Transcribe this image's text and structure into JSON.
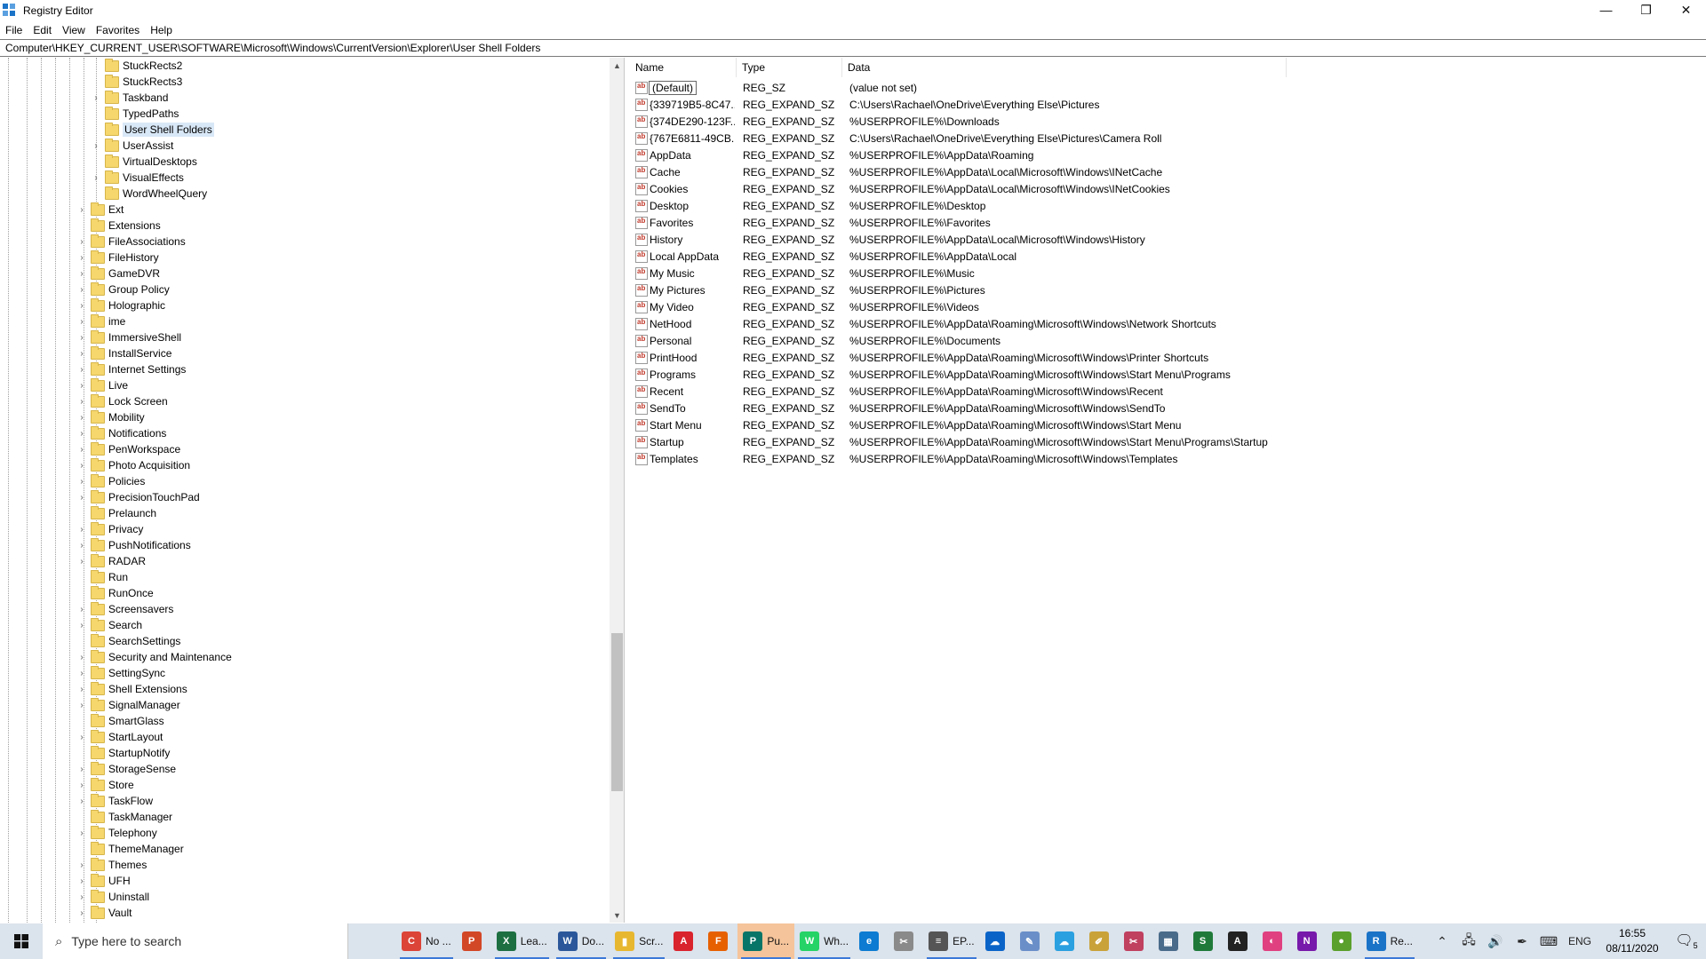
{
  "window": {
    "title": "Registry Editor"
  },
  "menu": [
    "File",
    "Edit",
    "View",
    "Favorites",
    "Help"
  ],
  "address": "Computer\\HKEY_CURRENT_USER\\SOFTWARE\\Microsoft\\Windows\\CurrentVersion\\Explorer\\User Shell Folders",
  "tree": [
    {
      "label": "StuckRects2",
      "level": 2,
      "expandable": false
    },
    {
      "label": "StuckRects3",
      "level": 2,
      "expandable": false
    },
    {
      "label": "Taskband",
      "level": 2,
      "expandable": true
    },
    {
      "label": "TypedPaths",
      "level": 2,
      "expandable": false
    },
    {
      "label": "User Shell Folders",
      "level": 2,
      "expandable": false,
      "selected": true
    },
    {
      "label": "UserAssist",
      "level": 2,
      "expandable": true
    },
    {
      "label": "VirtualDesktops",
      "level": 2,
      "expandable": false
    },
    {
      "label": "VisualEffects",
      "level": 2,
      "expandable": true
    },
    {
      "label": "WordWheelQuery",
      "level": 2,
      "expandable": false
    },
    {
      "label": "Ext",
      "level": 1,
      "expandable": true
    },
    {
      "label": "Extensions",
      "level": 1,
      "expandable": false
    },
    {
      "label": "FileAssociations",
      "level": 1,
      "expandable": true
    },
    {
      "label": "FileHistory",
      "level": 1,
      "expandable": true
    },
    {
      "label": "GameDVR",
      "level": 1,
      "expandable": true
    },
    {
      "label": "Group Policy",
      "level": 1,
      "expandable": true
    },
    {
      "label": "Holographic",
      "level": 1,
      "expandable": true
    },
    {
      "label": "ime",
      "level": 1,
      "expandable": true
    },
    {
      "label": "ImmersiveShell",
      "level": 1,
      "expandable": true
    },
    {
      "label": "InstallService",
      "level": 1,
      "expandable": true
    },
    {
      "label": "Internet Settings",
      "level": 1,
      "expandable": true
    },
    {
      "label": "Live",
      "level": 1,
      "expandable": true
    },
    {
      "label": "Lock Screen",
      "level": 1,
      "expandable": true
    },
    {
      "label": "Mobility",
      "level": 1,
      "expandable": true
    },
    {
      "label": "Notifications",
      "level": 1,
      "expandable": true
    },
    {
      "label": "PenWorkspace",
      "level": 1,
      "expandable": true
    },
    {
      "label": "Photo Acquisition",
      "level": 1,
      "expandable": true
    },
    {
      "label": "Policies",
      "level": 1,
      "expandable": true
    },
    {
      "label": "PrecisionTouchPad",
      "level": 1,
      "expandable": true
    },
    {
      "label": "Prelaunch",
      "level": 1,
      "expandable": false
    },
    {
      "label": "Privacy",
      "level": 1,
      "expandable": true
    },
    {
      "label": "PushNotifications",
      "level": 1,
      "expandable": true
    },
    {
      "label": "RADAR",
      "level": 1,
      "expandable": true
    },
    {
      "label": "Run",
      "level": 1,
      "expandable": false
    },
    {
      "label": "RunOnce",
      "level": 1,
      "expandable": false
    },
    {
      "label": "Screensavers",
      "level": 1,
      "expandable": true
    },
    {
      "label": "Search",
      "level": 1,
      "expandable": true
    },
    {
      "label": "SearchSettings",
      "level": 1,
      "expandable": false
    },
    {
      "label": "Security and Maintenance",
      "level": 1,
      "expandable": true
    },
    {
      "label": "SettingSync",
      "level": 1,
      "expandable": true
    },
    {
      "label": "Shell Extensions",
      "level": 1,
      "expandable": true
    },
    {
      "label": "SignalManager",
      "level": 1,
      "expandable": true
    },
    {
      "label": "SmartGlass",
      "level": 1,
      "expandable": false
    },
    {
      "label": "StartLayout",
      "level": 1,
      "expandable": true
    },
    {
      "label": "StartupNotify",
      "level": 1,
      "expandable": false
    },
    {
      "label": "StorageSense",
      "level": 1,
      "expandable": true
    },
    {
      "label": "Store",
      "level": 1,
      "expandable": true
    },
    {
      "label": "TaskFlow",
      "level": 1,
      "expandable": true
    },
    {
      "label": "TaskManager",
      "level": 1,
      "expandable": false
    },
    {
      "label": "Telephony",
      "level": 1,
      "expandable": true
    },
    {
      "label": "ThemeManager",
      "level": 1,
      "expandable": false
    },
    {
      "label": "Themes",
      "level": 1,
      "expandable": true
    },
    {
      "label": "UFH",
      "level": 1,
      "expandable": true
    },
    {
      "label": "Uninstall",
      "level": 1,
      "expandable": true
    },
    {
      "label": "Vault",
      "level": 1,
      "expandable": true
    }
  ],
  "columns": {
    "name": "Name",
    "type": "Type",
    "data": "Data"
  },
  "values": [
    {
      "name": "(Default)",
      "type": "REG_SZ",
      "data": "(value not set)"
    },
    {
      "name": "{339719B5-8C47...",
      "type": "REG_EXPAND_SZ",
      "data": "C:\\Users\\Rachael\\OneDrive\\Everything Else\\Pictures"
    },
    {
      "name": "{374DE290-123F...",
      "type": "REG_EXPAND_SZ",
      "data": "%USERPROFILE%\\Downloads"
    },
    {
      "name": "{767E6811-49CB...",
      "type": "REG_EXPAND_SZ",
      "data": "C:\\Users\\Rachael\\OneDrive\\Everything Else\\Pictures\\Camera Roll"
    },
    {
      "name": "AppData",
      "type": "REG_EXPAND_SZ",
      "data": "%USERPROFILE%\\AppData\\Roaming"
    },
    {
      "name": "Cache",
      "type": "REG_EXPAND_SZ",
      "data": "%USERPROFILE%\\AppData\\Local\\Microsoft\\Windows\\INetCache"
    },
    {
      "name": "Cookies",
      "type": "REG_EXPAND_SZ",
      "data": "%USERPROFILE%\\AppData\\Local\\Microsoft\\Windows\\INetCookies"
    },
    {
      "name": "Desktop",
      "type": "REG_EXPAND_SZ",
      "data": "%USERPROFILE%\\Desktop"
    },
    {
      "name": "Favorites",
      "type": "REG_EXPAND_SZ",
      "data": "%USERPROFILE%\\Favorites"
    },
    {
      "name": "History",
      "type": "REG_EXPAND_SZ",
      "data": "%USERPROFILE%\\AppData\\Local\\Microsoft\\Windows\\History"
    },
    {
      "name": "Local AppData",
      "type": "REG_EXPAND_SZ",
      "data": "%USERPROFILE%\\AppData\\Local"
    },
    {
      "name": "My Music",
      "type": "REG_EXPAND_SZ",
      "data": "%USERPROFILE%\\Music"
    },
    {
      "name": "My Pictures",
      "type": "REG_EXPAND_SZ",
      "data": "%USERPROFILE%\\Pictures"
    },
    {
      "name": "My Video",
      "type": "REG_EXPAND_SZ",
      "data": "%USERPROFILE%\\Videos"
    },
    {
      "name": "NetHood",
      "type": "REG_EXPAND_SZ",
      "data": "%USERPROFILE%\\AppData\\Roaming\\Microsoft\\Windows\\Network Shortcuts"
    },
    {
      "name": "Personal",
      "type": "REG_EXPAND_SZ",
      "data": "%USERPROFILE%\\Documents"
    },
    {
      "name": "PrintHood",
      "type": "REG_EXPAND_SZ",
      "data": "%USERPROFILE%\\AppData\\Roaming\\Microsoft\\Windows\\Printer Shortcuts"
    },
    {
      "name": "Programs",
      "type": "REG_EXPAND_SZ",
      "data": "%USERPROFILE%\\AppData\\Roaming\\Microsoft\\Windows\\Start Menu\\Programs"
    },
    {
      "name": "Recent",
      "type": "REG_EXPAND_SZ",
      "data": "%USERPROFILE%\\AppData\\Roaming\\Microsoft\\Windows\\Recent"
    },
    {
      "name": "SendTo",
      "type": "REG_EXPAND_SZ",
      "data": "%USERPROFILE%\\AppData\\Roaming\\Microsoft\\Windows\\SendTo"
    },
    {
      "name": "Start Menu",
      "type": "REG_EXPAND_SZ",
      "data": "%USERPROFILE%\\AppData\\Roaming\\Microsoft\\Windows\\Start Menu"
    },
    {
      "name": "Startup",
      "type": "REG_EXPAND_SZ",
      "data": "%USERPROFILE%\\AppData\\Roaming\\Microsoft\\Windows\\Start Menu\\Programs\\Startup"
    },
    {
      "name": "Templates",
      "type": "REG_EXPAND_SZ",
      "data": "%USERPROFILE%\\AppData\\Roaming\\Microsoft\\Windows\\Templates"
    }
  ],
  "taskbar": {
    "search_placeholder": "Type here to search",
    "apps": [
      {
        "name": "chrome",
        "label": "No ...",
        "color": "#db4437",
        "glyph": "C"
      },
      {
        "name": "powerpoint",
        "label": "",
        "color": "#d24726",
        "glyph": "P"
      },
      {
        "name": "excel",
        "label": "Lea...",
        "color": "#1d6f42",
        "glyph": "X"
      },
      {
        "name": "word",
        "label": "Do...",
        "color": "#2b579a",
        "glyph": "W"
      },
      {
        "name": "explorer",
        "label": "Scr...",
        "color": "#e8b730",
        "glyph": "▮"
      },
      {
        "name": "acrobat",
        "label": "",
        "color": "#d9232d",
        "glyph": "A"
      },
      {
        "name": "firefox",
        "label": "",
        "color": "#e66000",
        "glyph": "F"
      },
      {
        "name": "publisher",
        "label": "Pu...",
        "color": "#077568",
        "glyph": "P"
      },
      {
        "name": "whatsapp",
        "label": "Wh...",
        "color": "#25d366",
        "glyph": "W"
      },
      {
        "name": "edge",
        "label": "",
        "color": "#0c7bd1",
        "glyph": "e"
      },
      {
        "name": "snipping",
        "label": "",
        "color": "#8a8a8a",
        "glyph": "✂"
      },
      {
        "name": "ep",
        "label": "EP...",
        "color": "#555555",
        "glyph": "≡"
      },
      {
        "name": "onedrive",
        "label": "",
        "color": "#0a64c8",
        "glyph": "☁"
      },
      {
        "name": "feather",
        "label": "",
        "color": "#6a8fc8",
        "glyph": "✎"
      },
      {
        "name": "cloud",
        "label": "",
        "color": "#2aa0e0",
        "glyph": "☁"
      },
      {
        "name": "paint",
        "label": "",
        "color": "#c9a23a",
        "glyph": "✐"
      },
      {
        "name": "snip",
        "label": "",
        "color": "#c04060",
        "glyph": "✂"
      },
      {
        "name": "calculator",
        "label": "",
        "color": "#4a6b8a",
        "glyph": "▦"
      },
      {
        "name": "scribus",
        "label": "",
        "color": "#1f7a3a",
        "glyph": "S"
      },
      {
        "name": "acrobat-2",
        "label": "",
        "color": "#222222",
        "glyph": "A"
      },
      {
        "name": "photo",
        "label": "",
        "color": "#e04080",
        "glyph": "◐"
      },
      {
        "name": "onenote",
        "label": "",
        "color": "#7719aa",
        "glyph": "N"
      },
      {
        "name": "green-app",
        "label": "",
        "color": "#5aa02c",
        "glyph": "●"
      },
      {
        "name": "regedit",
        "label": "Re...",
        "color": "#1a73c7",
        "glyph": "R"
      }
    ],
    "language": "ENG",
    "time": "16:55",
    "date": "08/11/2020",
    "notification_count": "5"
  }
}
